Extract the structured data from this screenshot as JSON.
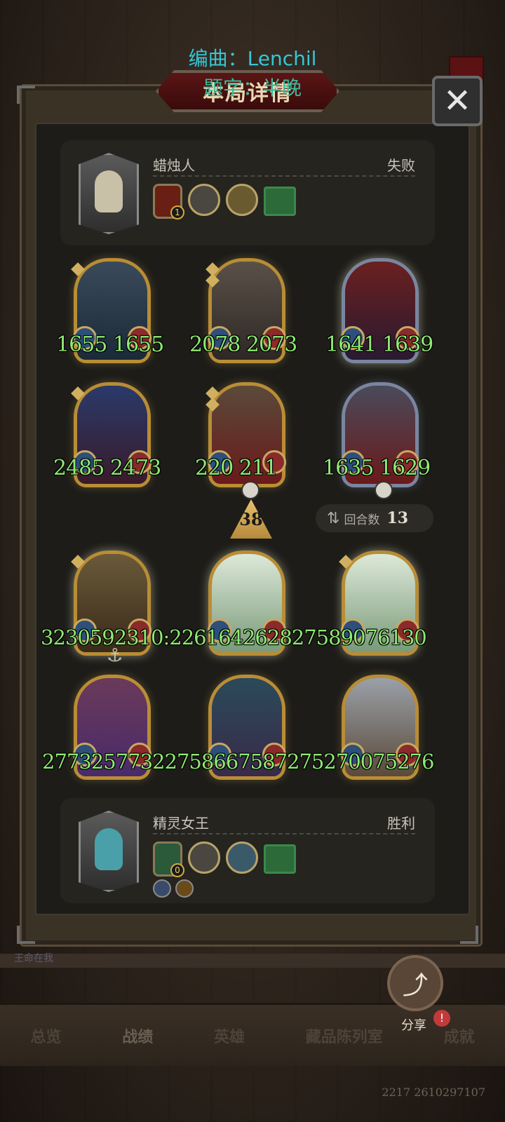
{
  "overlay": {
    "credit_line1": "编曲：Lenchil",
    "credit_line2": "题字：半晚"
  },
  "dialog": {
    "title": "本局详情",
    "close_icon": "close-icon"
  },
  "player_top": {
    "name": "蜡烛人",
    "result": "失败",
    "lamp_level": "1"
  },
  "player_bottom": {
    "name": "精灵女王",
    "result": "胜利",
    "lamp_level": "0"
  },
  "damage": {
    "r1c1": "1655 1655",
    "r1c2": "2078 2073",
    "r1c3": "1641  1639",
    "r2c1": "2485 2473",
    "r2c2": "220    211",
    "r2c3": "1635  1629",
    "r3": "3230592310:226164262827589076130",
    "r4": "27732577322758667587275270075276"
  },
  "attack": {
    "value": "38"
  },
  "rounds": {
    "label": "回合数",
    "value": "13"
  },
  "nav": {
    "tabs": [
      "总览",
      "战绩",
      "英雄",
      "藏品陈列室",
      "成就"
    ],
    "active_index": 1,
    "strip_label": "王命在我"
  },
  "share": {
    "label": "分享",
    "badge": "!"
  },
  "build": "2217 2610297107",
  "colors": {
    "damage_text": "#8ee873",
    "card_gold": "#b98d35",
    "card_silver": "#7a86a0",
    "title_red": "#5a1515"
  }
}
